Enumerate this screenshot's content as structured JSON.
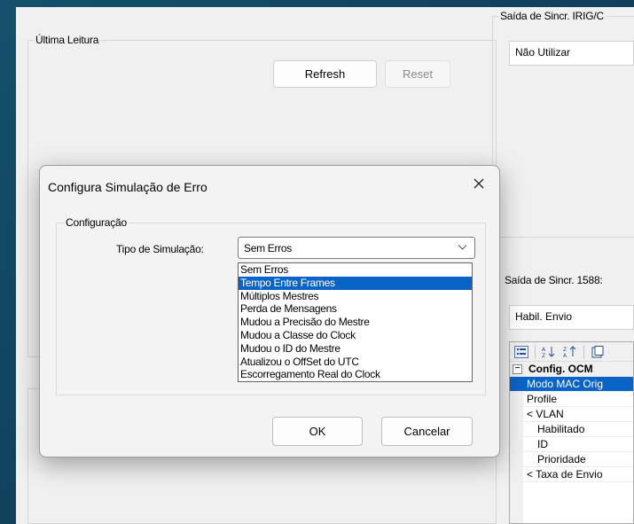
{
  "main": {
    "last_reading": {
      "legend": "Última Leitura",
      "refresh_label": "Refresh",
      "reset_label": "Reset"
    },
    "irig_output": {
      "legend": "Saída de Sincr. IRIG/C",
      "value": "Não Utilizar"
    },
    "sync_1588": {
      "label": "Saída de Sincr. 1588:",
      "value": "Habil. Envio"
    },
    "property_grid": {
      "rows": [
        {
          "label": "Config. OCM",
          "kind": "category"
        },
        {
          "label": "Modo MAC Orig",
          "kind": "selected"
        },
        {
          "label": "Profile",
          "kind": "normal"
        },
        {
          "label": "< VLAN",
          "kind": "normal"
        },
        {
          "label": "Habilitado",
          "kind": "indent"
        },
        {
          "label": "ID",
          "kind": "indent"
        },
        {
          "label": "Prioridade",
          "kind": "indent"
        },
        {
          "label": "< Taxa de Envio",
          "kind": "normal"
        }
      ]
    }
  },
  "dialog": {
    "title": "Configura Simulação de Erro",
    "group_legend": "Configuração",
    "sim_type_label": "Tipo de Simulação:",
    "selected_value": "Sem Erros",
    "options": [
      "Sem Erros",
      "Tempo Entre Frames",
      "Múltiplos Mestres",
      "Perda de Mensagens",
      "Mudou a Precisão do Mestre",
      "Mudou a Classe do Clock",
      "Mudou o ID do Mestre",
      "Atualizou o OffSet do UTC",
      "Escorregamento Real do Clock"
    ],
    "highlighted_index": 1,
    "ok_label": "OK",
    "cancel_label": "Cancelar"
  }
}
